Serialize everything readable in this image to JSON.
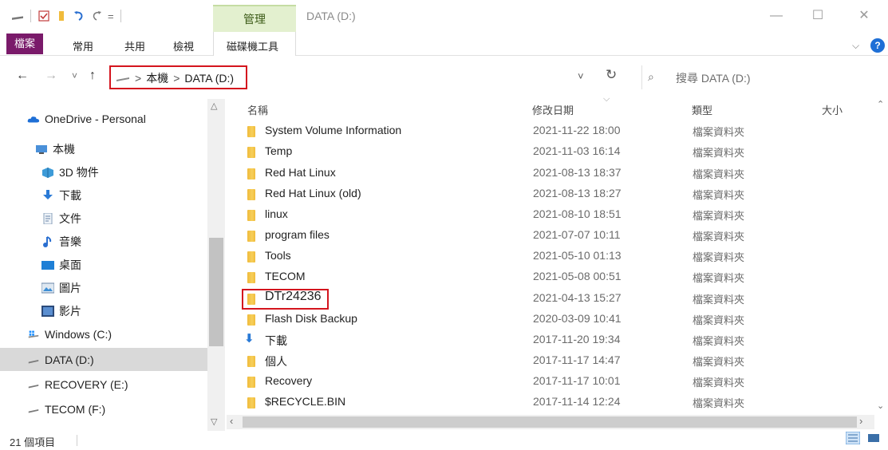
{
  "window": {
    "title": "DATA (D:)",
    "context_tab": "管理",
    "controls": {
      "minimize": "—",
      "maximize": "☐",
      "close": "✕"
    }
  },
  "quick_access": {
    "dropdown": "="
  },
  "ribbon": {
    "file": "檔案",
    "tabs": [
      "常用",
      "共用",
      "檢視"
    ],
    "drive_tools": "磁碟機工具",
    "help": "?"
  },
  "address": {
    "back": "←",
    "forward": "→",
    "recent": "˅",
    "up": "↑",
    "crumbs": [
      "本機",
      "DATA (D:)"
    ],
    "separator": ">",
    "dropdown": "˅",
    "refresh": "↻",
    "search_placeholder": "搜尋 DATA (D:)"
  },
  "nav": {
    "items": [
      {
        "label": "OneDrive - Personal",
        "icon": "cloud-icon",
        "selected": false
      },
      {
        "label": "本機",
        "icon": "computer-icon",
        "selected": false
      },
      {
        "label": "3D 物件",
        "icon": "3d-objects-icon",
        "selected": false
      },
      {
        "label": "下載",
        "icon": "download-icon",
        "selected": false
      },
      {
        "label": "文件",
        "icon": "document-icon",
        "selected": false
      },
      {
        "label": "音樂",
        "icon": "music-icon",
        "selected": false
      },
      {
        "label": "桌面",
        "icon": "desktop-icon",
        "selected": false
      },
      {
        "label": "圖片",
        "icon": "pictures-icon",
        "selected": false
      },
      {
        "label": "影片",
        "icon": "videos-icon",
        "selected": false
      },
      {
        "label": "Windows (C:)",
        "icon": "windows-drive-icon",
        "selected": false
      },
      {
        "label": "DATA (D:)",
        "icon": "drive-icon",
        "selected": true
      },
      {
        "label": "RECOVERY (E:)",
        "icon": "drive-icon",
        "selected": false
      },
      {
        "label": "TECOM (F:)",
        "icon": "drive-icon",
        "selected": false
      }
    ]
  },
  "columns": {
    "name": "名稱",
    "modified": "修改日期",
    "type": "類型",
    "size": "大小"
  },
  "files": [
    {
      "name": "System Volume Information",
      "modified": "2021-11-22 18:00",
      "type": "檔案資料夾",
      "icon": "folder-icon"
    },
    {
      "name": "Temp",
      "modified": "2021-11-03 16:14",
      "type": "檔案資料夾",
      "icon": "folder-icon"
    },
    {
      "name": "Red Hat Linux",
      "modified": "2021-08-13 18:37",
      "type": "檔案資料夾",
      "icon": "folder-icon"
    },
    {
      "name": "Red Hat Linux (old)",
      "modified": "2021-08-13 18:27",
      "type": "檔案資料夾",
      "icon": "folder-icon"
    },
    {
      "name": "linux",
      "modified": "2021-08-10 18:51",
      "type": "檔案資料夾",
      "icon": "folder-icon"
    },
    {
      "name": "program files",
      "modified": "2021-07-07 10:11",
      "type": "檔案資料夾",
      "icon": "folder-icon"
    },
    {
      "name": "Tools",
      "modified": "2021-05-10 01:13",
      "type": "檔案資料夾",
      "icon": "folder-icon"
    },
    {
      "name": "TECOM",
      "modified": "2021-05-08 00:51",
      "type": "檔案資料夾",
      "icon": "folder-icon"
    },
    {
      "name": "DTr24236",
      "modified": "2021-04-13 15:27",
      "type": "檔案資料夾",
      "icon": "folder-icon",
      "highlighted": true
    },
    {
      "name": "Flash Disk Backup",
      "modified": "2020-03-09 10:41",
      "type": "檔案資料夾",
      "icon": "folder-icon"
    },
    {
      "name": "下載",
      "modified": "2017-11-20 19:34",
      "type": "檔案資料夾",
      "icon": "download-icon"
    },
    {
      "name": "個人",
      "modified": "2017-11-17 14:47",
      "type": "檔案資料夾",
      "icon": "folder-icon"
    },
    {
      "name": "Recovery",
      "modified": "2017-11-17 10:01",
      "type": "檔案資料夾",
      "icon": "folder-icon"
    },
    {
      "name": "$RECYCLE.BIN",
      "modified": "2017-11-14 12:24",
      "type": "檔案資料夾",
      "icon": "folder-icon"
    }
  ],
  "status": {
    "count": "21 個項目"
  },
  "colors": {
    "file_tab": "#7a1a6a",
    "highlight_box": "#d4151e",
    "selection": "#d9d9d9",
    "folder": "#f0bb3b",
    "context_tab": "#e3f0cf"
  }
}
